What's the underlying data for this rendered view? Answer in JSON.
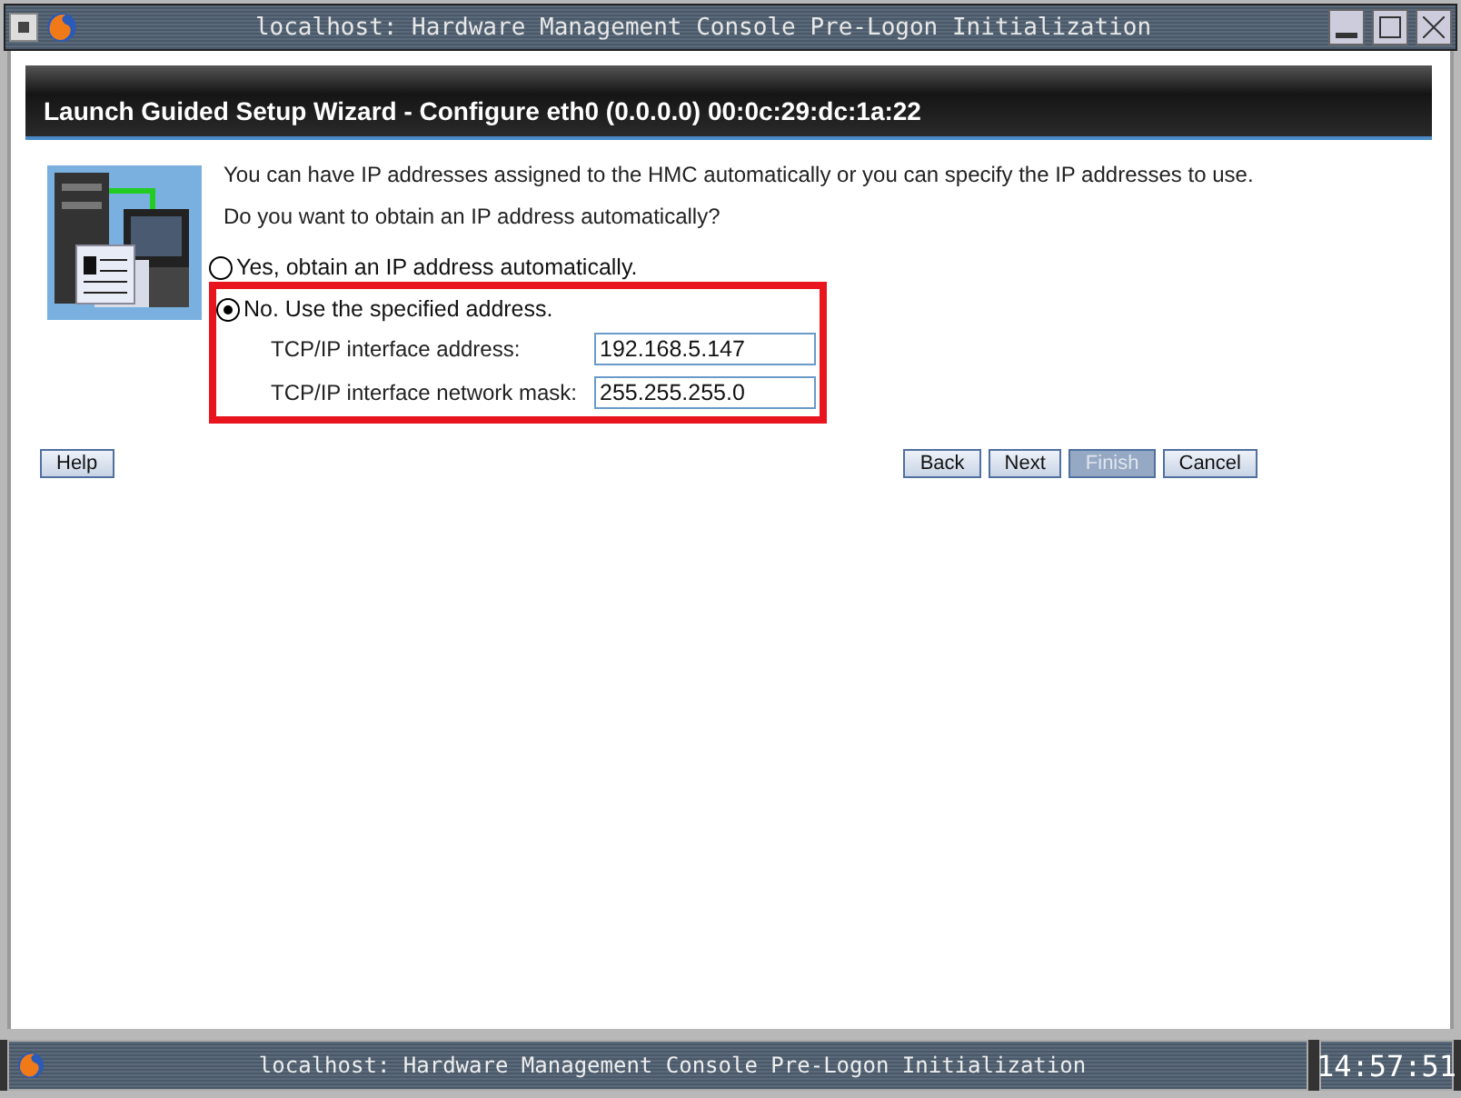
{
  "window": {
    "title": "localhost: Hardware Management Console Pre-Logon Initialization"
  },
  "wizard": {
    "title": "Launch Guided Setup Wizard - Configure eth0 (0.0.0.0) 00:0c:29:dc:1a:22",
    "intro": "You can have IP addresses assigned to the HMC automatically or you can specify the IP addresses to use.",
    "question": "Do you want to obtain an IP address automatically?",
    "options": [
      {
        "label": "Yes, obtain an IP address automatically.",
        "selected": false
      },
      {
        "label": "No. Use the specified address.",
        "selected": true
      }
    ],
    "fields": [
      {
        "label": "TCP/IP interface address:",
        "value": "192.168.5.147"
      },
      {
        "label": "TCP/IP interface network mask:",
        "value": "255.255.255.0"
      }
    ],
    "help_button": "Help",
    "buttons": [
      {
        "label": "Back",
        "disabled": false
      },
      {
        "label": "Next",
        "disabled": false
      },
      {
        "label": "Finish",
        "disabled": true
      },
      {
        "label": "Cancel",
        "disabled": false
      }
    ]
  },
  "taskbar": {
    "task": "localhost: Hardware Management Console Pre-Logon Initialization",
    "clock": "14:57:51"
  }
}
